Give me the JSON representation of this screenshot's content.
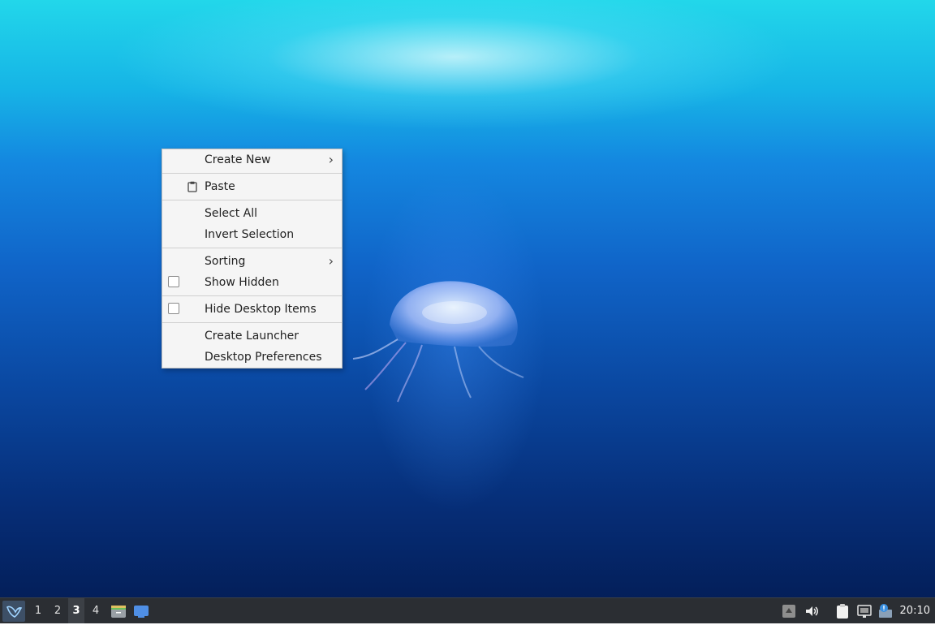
{
  "desktop": {
    "wallpaper": "jellyfish-underwater"
  },
  "context_menu": {
    "create_new": "Create New",
    "paste": "Paste",
    "select_all": "Select All",
    "invert_selection": "Invert Selection",
    "sorting": "Sorting",
    "show_hidden": "Show Hidden",
    "hide_desktop_items": "Hide Desktop Items",
    "create_launcher": "Create Launcher",
    "desktop_preferences": "Desktop Preferences",
    "submenu_indicator": "›"
  },
  "taskbar": {
    "workspaces": [
      "1",
      "2",
      "3",
      "4"
    ],
    "active_workspace": "3",
    "clock": "20:10",
    "colors": {
      "bar": "#2b2e33",
      "start_button": "#3d4f66"
    }
  }
}
